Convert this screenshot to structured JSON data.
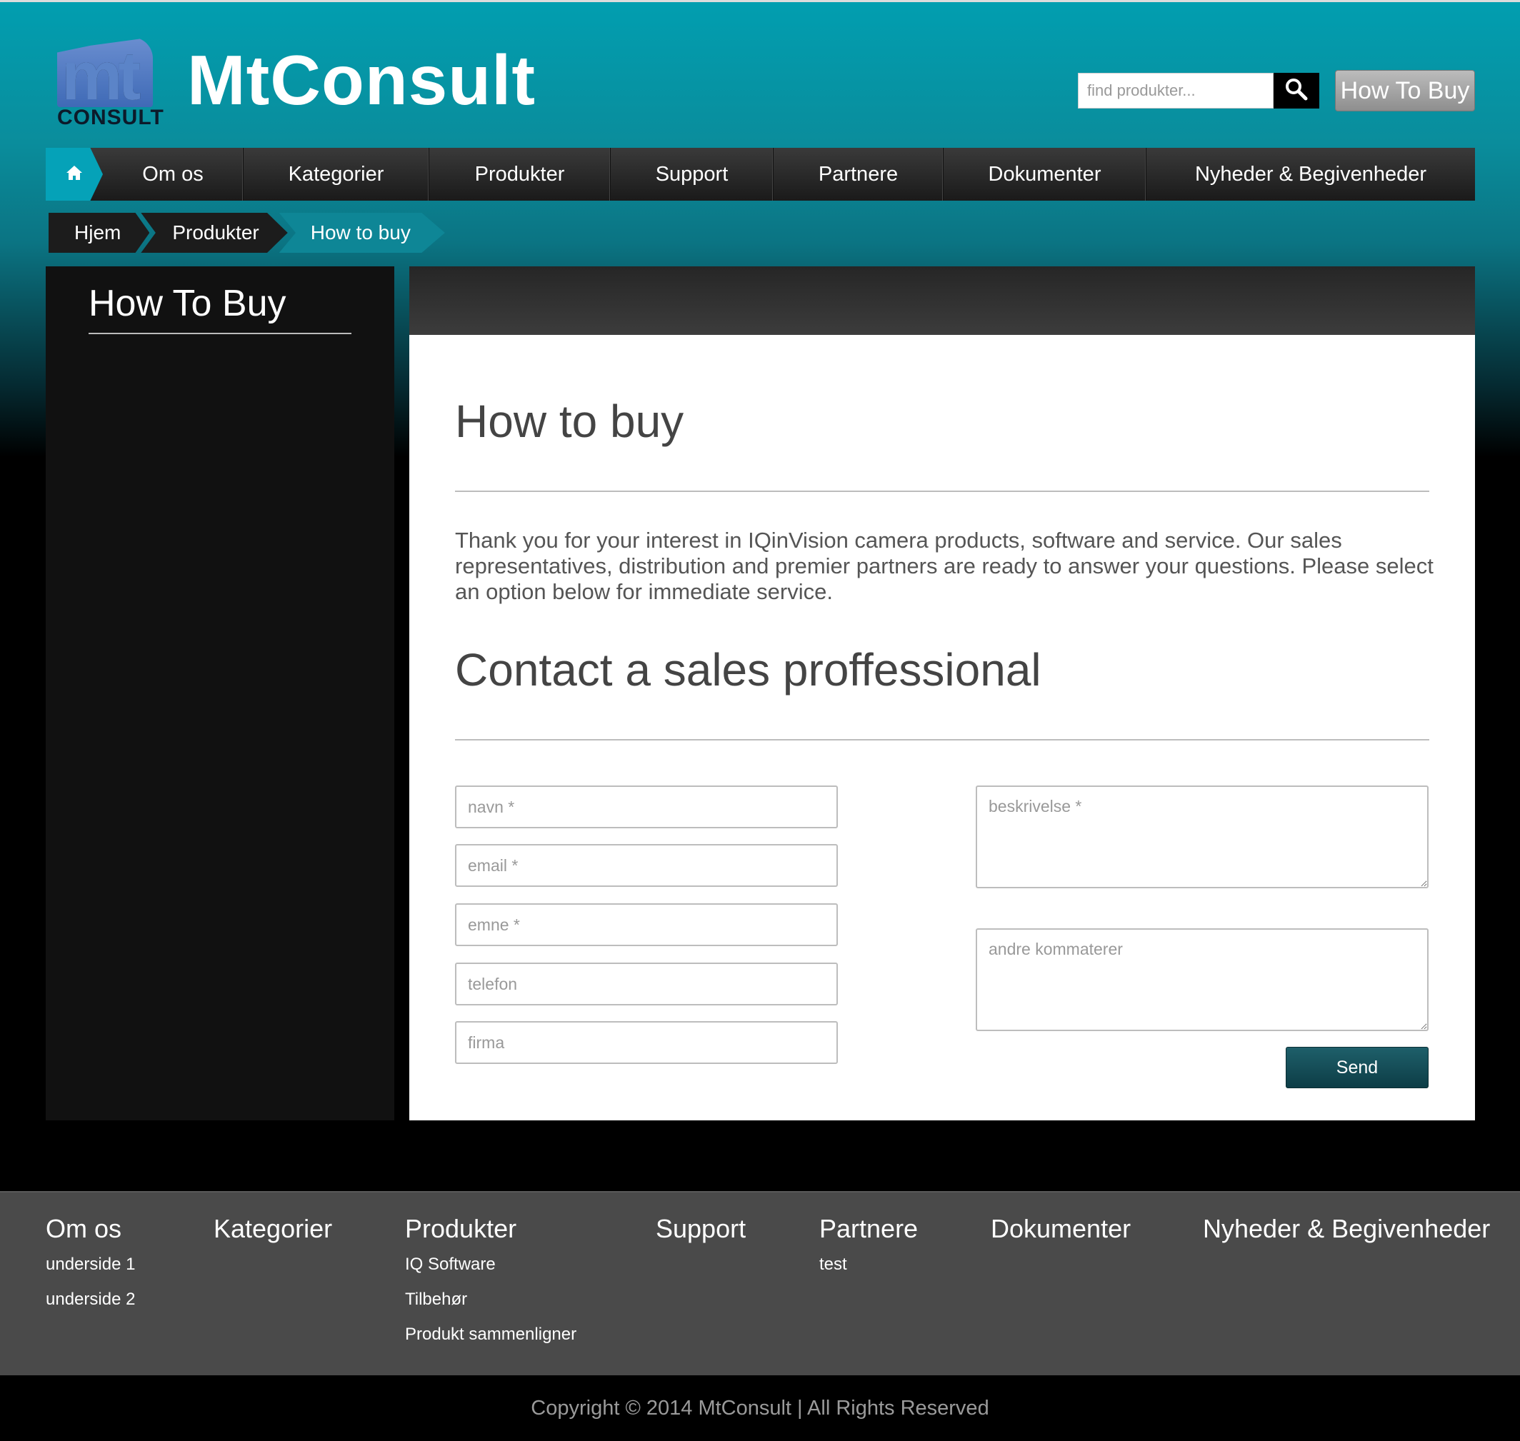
{
  "header": {
    "logo_letters": "mt",
    "logo_word": "CONSULT",
    "brand": "MtConsult",
    "search_placeholder": "find produkter...",
    "how_to_buy_button": "How To Buy"
  },
  "nav": {
    "items": [
      {
        "label": "Om os"
      },
      {
        "label": "Kategorier"
      },
      {
        "label": "Produkter"
      },
      {
        "label": "Support"
      },
      {
        "label": "Partnere"
      },
      {
        "label": "Dokumenter"
      },
      {
        "label": "Nyheder & Begivenheder"
      }
    ]
  },
  "breadcrumb": [
    "Hjem",
    "Produkter",
    "How to buy"
  ],
  "sidebar": {
    "title": "How To Buy"
  },
  "main": {
    "heading": "How to buy",
    "intro": "Thank you for your interest in IQinVision camera products, software and service. Our sales representatives, distribution and premier partners are ready to answer your questions. Please select an option below for immediate service.",
    "contact_heading": "Contact a sales proffessional",
    "form": {
      "name_placeholder": "navn *",
      "email_placeholder": "email *",
      "subject_placeholder": "emne *",
      "phone_placeholder": "telefon",
      "company_placeholder": "firma",
      "description_placeholder": "beskrivelse *",
      "comments_placeholder": "andre kommaterer",
      "send_label": "Send"
    }
  },
  "footer": {
    "columns": [
      {
        "title": "Om os",
        "links": [
          "underside 1",
          "underside 2"
        ]
      },
      {
        "title": "Kategorier",
        "links": []
      },
      {
        "title": "Produkter",
        "links": [
          "IQ Software",
          "Tilbehør",
          "Produkt sammenligner"
        ]
      },
      {
        "title": "Support",
        "links": []
      },
      {
        "title": "Partnere",
        "links": [
          "test"
        ]
      },
      {
        "title": "Dokumenter",
        "links": []
      },
      {
        "title": "Nyheder & Begivenheder",
        "links": []
      }
    ],
    "copyright": "Copyright © 2014 MtConsult | All Rights Reserved"
  },
  "colors": {
    "accent": "#019eb0",
    "nav_bg": "#2a2a2a",
    "send_button": "#164f59"
  },
  "icons": {
    "search": "search-icon",
    "home": "home-icon"
  }
}
